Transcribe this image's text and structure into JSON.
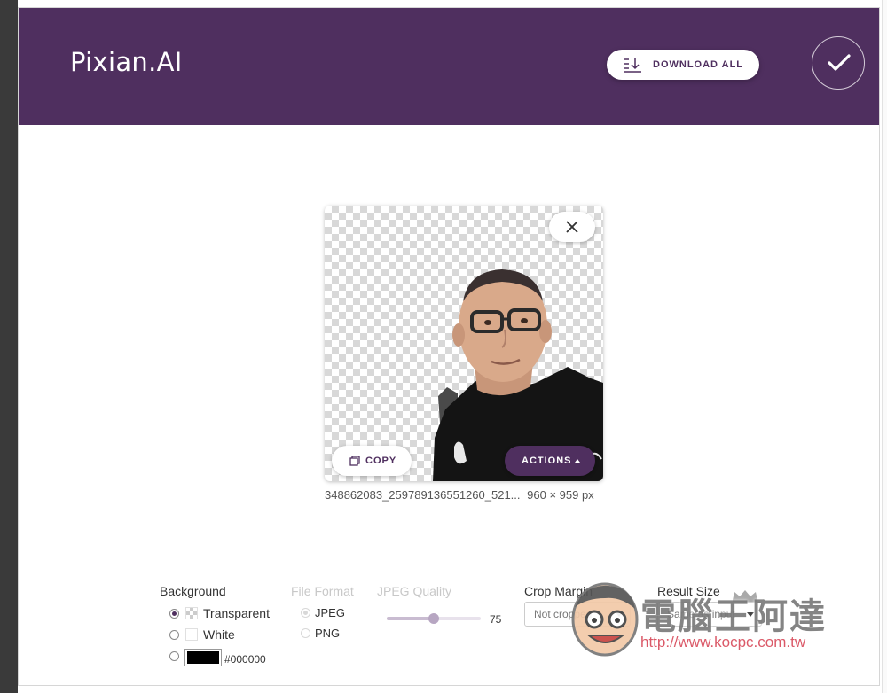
{
  "header": {
    "brand": "Pixian.AI",
    "download_all_label": "DOWNLOAD ALL",
    "colors": {
      "header_bg": "#4f2f5f",
      "accent": "#4f2f5f"
    }
  },
  "image_card": {
    "copy_label": "COPY",
    "actions_label": "ACTIONS",
    "filename": "348862083_259789136551260_521...",
    "dimensions": "960 × 959 px"
  },
  "options": {
    "background": {
      "title": "Background",
      "choices": [
        {
          "label": "Transparent",
          "selected": true
        },
        {
          "label": "White",
          "selected": false
        },
        {
          "label": "#000000",
          "selected": false
        }
      ],
      "custom_color": "#000000"
    },
    "file_format": {
      "title": "File Format",
      "choices": [
        {
          "label": "JPEG",
          "selected": true
        },
        {
          "label": "PNG",
          "selected": false
        }
      ]
    },
    "jpeg_quality": {
      "title": "JPEG Quality",
      "value": "75",
      "fraction": 0.5
    },
    "crop_margin": {
      "title": "Crop Margin",
      "value": "Not cropped"
    },
    "result_size": {
      "title": "Result Size",
      "value": "Same as input"
    }
  },
  "watermark": {
    "text": "電腦王阿達",
    "url": "http://www.kocpc.com.tw"
  },
  "icons": [
    "download-all-icon",
    "checkmark-icon",
    "close-icon",
    "copy-icon",
    "caret-up-icon",
    "crown-icon",
    "caret-down-icon"
  ]
}
